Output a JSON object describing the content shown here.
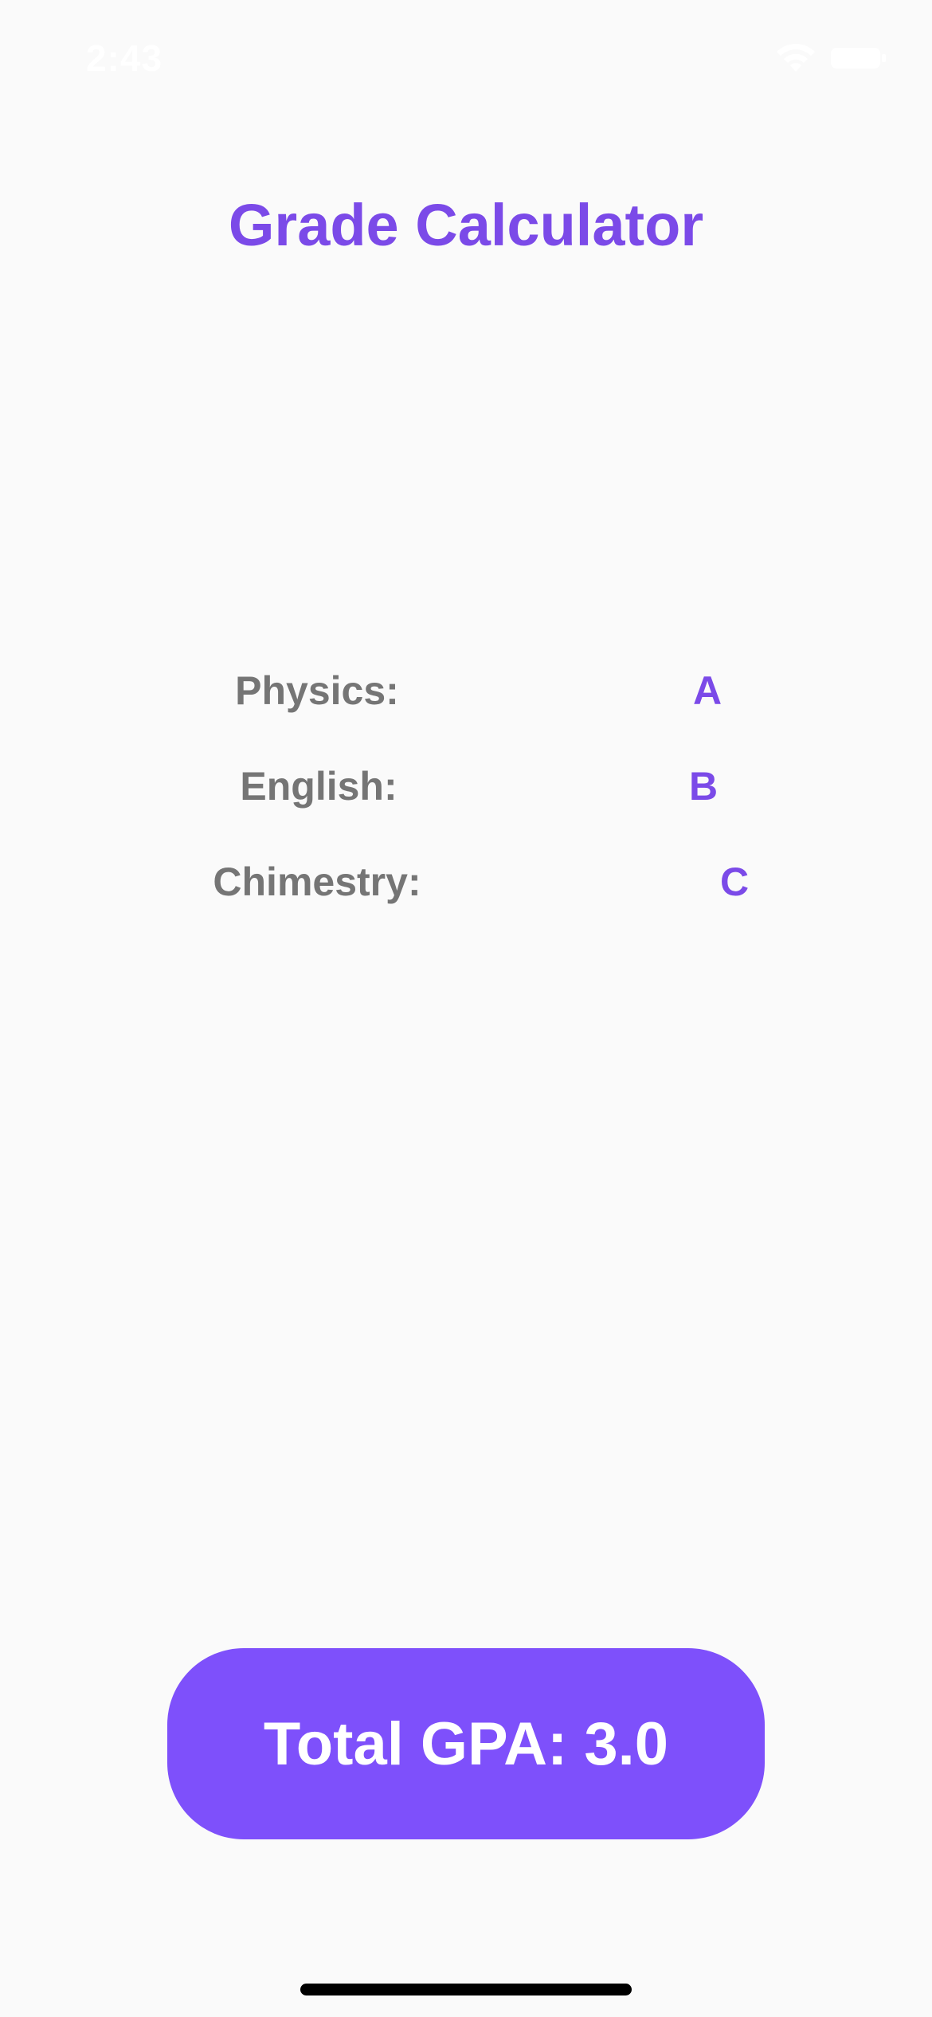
{
  "status_bar": {
    "time": "2:43",
    "wifi_icon": "wifi-icon",
    "battery_icon": "battery-icon"
  },
  "header": {
    "title": "Grade Calculator"
  },
  "grades": [
    {
      "subject": "Physics:",
      "grade": "A"
    },
    {
      "subject": "English:",
      "grade": "B"
    },
    {
      "subject": "Chimestry:",
      "grade": "C"
    }
  ],
  "footer": {
    "gpa_button_label": "Total GPA: 3.0"
  },
  "colors": {
    "accent": "#7b4ae8",
    "button": "#7e50fb",
    "label": "#757575",
    "background": "#fafafa"
  }
}
